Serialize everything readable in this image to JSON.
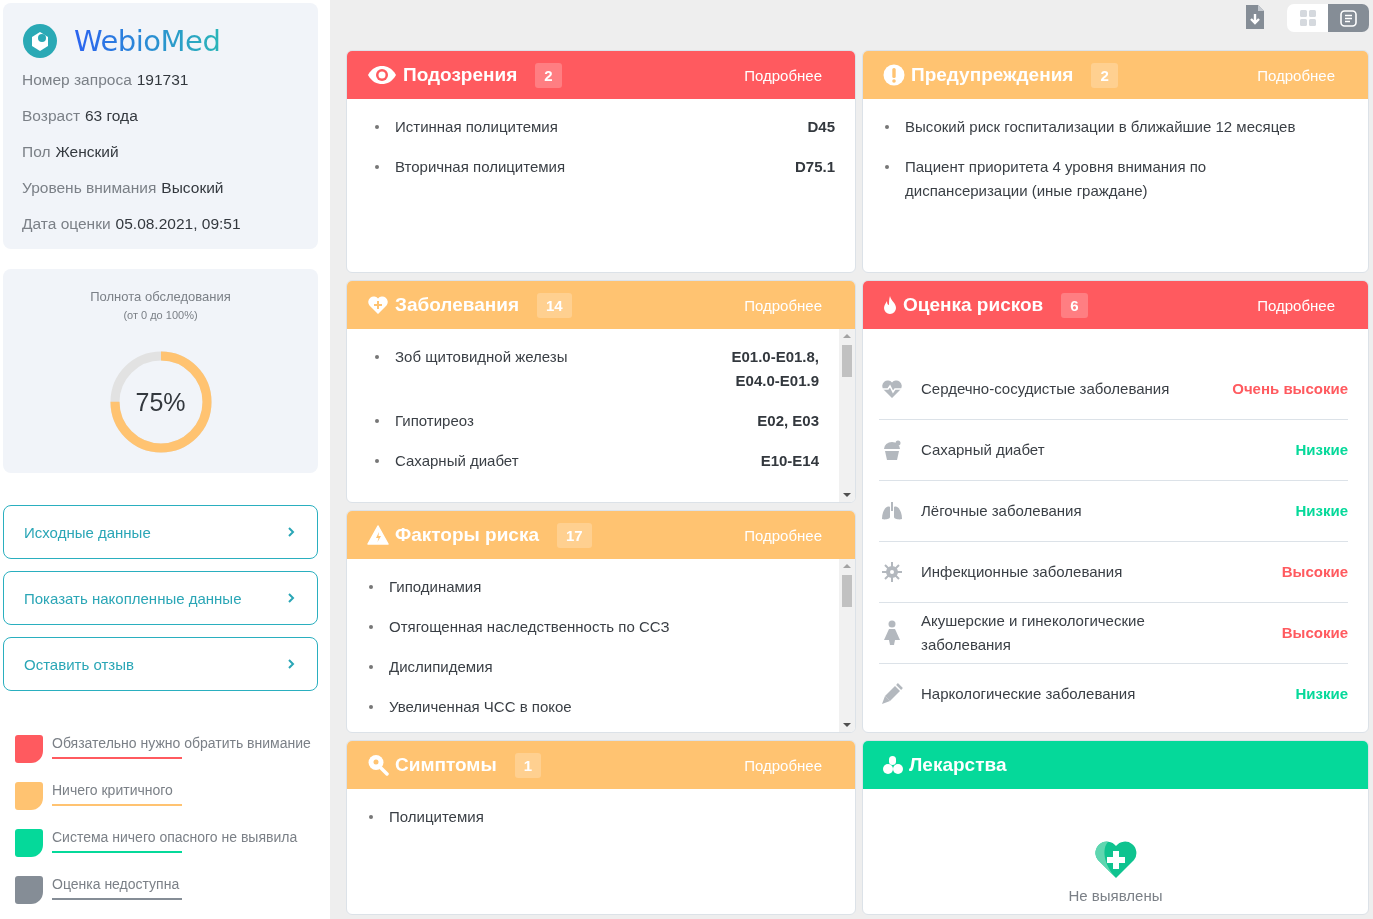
{
  "sidebar": {
    "logo": "WebioMed",
    "info": [
      {
        "label": "Номер запроса",
        "value": "191731"
      },
      {
        "label": "Возраст",
        "value": "63 года"
      },
      {
        "label": "Пол",
        "value": "Женский"
      },
      {
        "label": "Уровень внимания",
        "value": "Высокий"
      },
      {
        "label": "Дата оценки",
        "value": "05.08.2021, 09:51"
      }
    ],
    "completeness": {
      "title": "Полнота обследования",
      "subtitle": "(от 0 до 100%)",
      "value": "75%",
      "level": 0.75
    },
    "buttons": [
      "Исходные данные",
      "Показать накопленные данные",
      "Оставить отзыв"
    ],
    "legend": [
      {
        "label": "Обязательно нужно обратить внимание",
        "color": "#ff5a5f"
      },
      {
        "label": "Ничего критичного",
        "color": "#ffc371"
      },
      {
        "label": "Система ничего опасного не выявила",
        "color": "#05d99a"
      },
      {
        "label": "Оценка недоступна",
        "color": "#858d96"
      }
    ]
  },
  "toolbar": {
    "view_toggle": [
      {
        "selected": false
      },
      {
        "selected": true
      }
    ]
  },
  "cards": [
    {
      "kind": "codes",
      "title": "Подозрения",
      "count": "2",
      "more": "Подробнее",
      "color": "#ff5a5f",
      "scrollable": false,
      "items": [
        {
          "name": "Истинная полицитемия",
          "code": "D45"
        },
        {
          "name": "Вторичная полицитемия",
          "code": "D75.1"
        }
      ]
    },
    {
      "kind": "bullets",
      "title": "Предупреждения",
      "count": "2",
      "more": "Подробнее",
      "color": "#ffc371",
      "scrollable": false,
      "items": [
        "Высокий риск госпитализации в ближайшие 12 месяцев",
        "Пациент приоритета 4 уровня внимания по диспансеризации (иные граждане)"
      ]
    },
    {
      "kind": "codes",
      "title": "Заболевания",
      "count": "14",
      "more": "Подробнее",
      "color": "#ffc371",
      "scrollable": true,
      "items": [
        {
          "name": "Зоб щитовидной железы",
          "code": "E01.0-E01.8, E04.0-E01.9"
        },
        {
          "name": "Гипотиреоз",
          "code": "E02, E03"
        },
        {
          "name": "Сахарный диабет",
          "code": "E10-E14"
        }
      ]
    },
    {
      "kind": "risks",
      "title": "Оценка рисков",
      "count": "6",
      "more": "Подробнее",
      "color": "#ff5a5f",
      "scrollable": false,
      "items": [
        {
          "name": "Сердечно-сосудистые заболевания",
          "level": "Очень высокие",
          "color": "#ff5a5f"
        },
        {
          "name": "Сахарный диабет",
          "level": "Низкие",
          "color": "#05d99a"
        },
        {
          "name": "Лёгочные заболевания",
          "level": "Низкие",
          "color": "#05d99a"
        },
        {
          "name": "Инфекционные заболевания",
          "level": "Высокие",
          "color": "#ff5a5f"
        },
        {
          "name": "Акушерские и гинекологические заболевания",
          "level": "Высокие",
          "color": "#ff5a5f"
        },
        {
          "name": "Наркологические заболевания",
          "level": "Низкие",
          "color": "#05d99a"
        }
      ]
    },
    {
      "kind": "bullets",
      "title": "Факторы риска",
      "count": "17",
      "more": "Подробнее",
      "color": "#ffc371",
      "scrollable": true,
      "items": [
        "Гиподинамия",
        "Отягощенная наследственность по ССЗ",
        "Дислипидемия",
        "Увеличенная ЧСС в покое"
      ]
    },
    {
      "kind": "bullets",
      "title": "Симптомы",
      "count": "1",
      "more": "Подробнее",
      "color": "#ffc371",
      "scrollable": false,
      "items": [
        "Полицитемия"
      ]
    },
    {
      "kind": "empty",
      "title": "Лекарства",
      "color": "#05d99a",
      "scrollable": false,
      "message": "Не выявлены"
    }
  ]
}
